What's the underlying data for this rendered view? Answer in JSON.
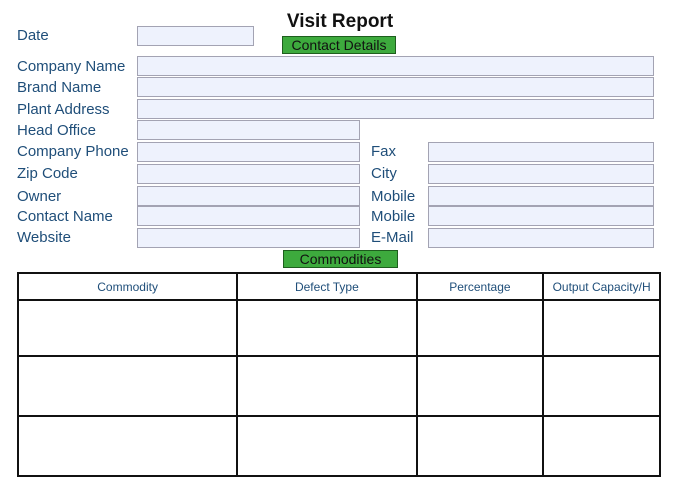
{
  "title": "Visit Report",
  "sections": {
    "contact": "Contact Details",
    "commodities": "Commodities"
  },
  "labels": {
    "date": "Date",
    "company_name": "Company Name",
    "brand_name": "Brand  Name",
    "plant_address": "Plant Address",
    "head_office": "Head Office",
    "company_phone": "Company Phone",
    "fax": "Fax",
    "zip_code": "Zip Code",
    "city": "City",
    "owner": "Owner",
    "mobile1": "Mobile",
    "contact_name": "Contact Name",
    "mobile2": "Mobile",
    "website": "Website",
    "email": "E-Mail"
  },
  "table": {
    "headers": [
      "Commodity",
      "Defect Type",
      "Percentage",
      "Output Capacity/H"
    ]
  }
}
